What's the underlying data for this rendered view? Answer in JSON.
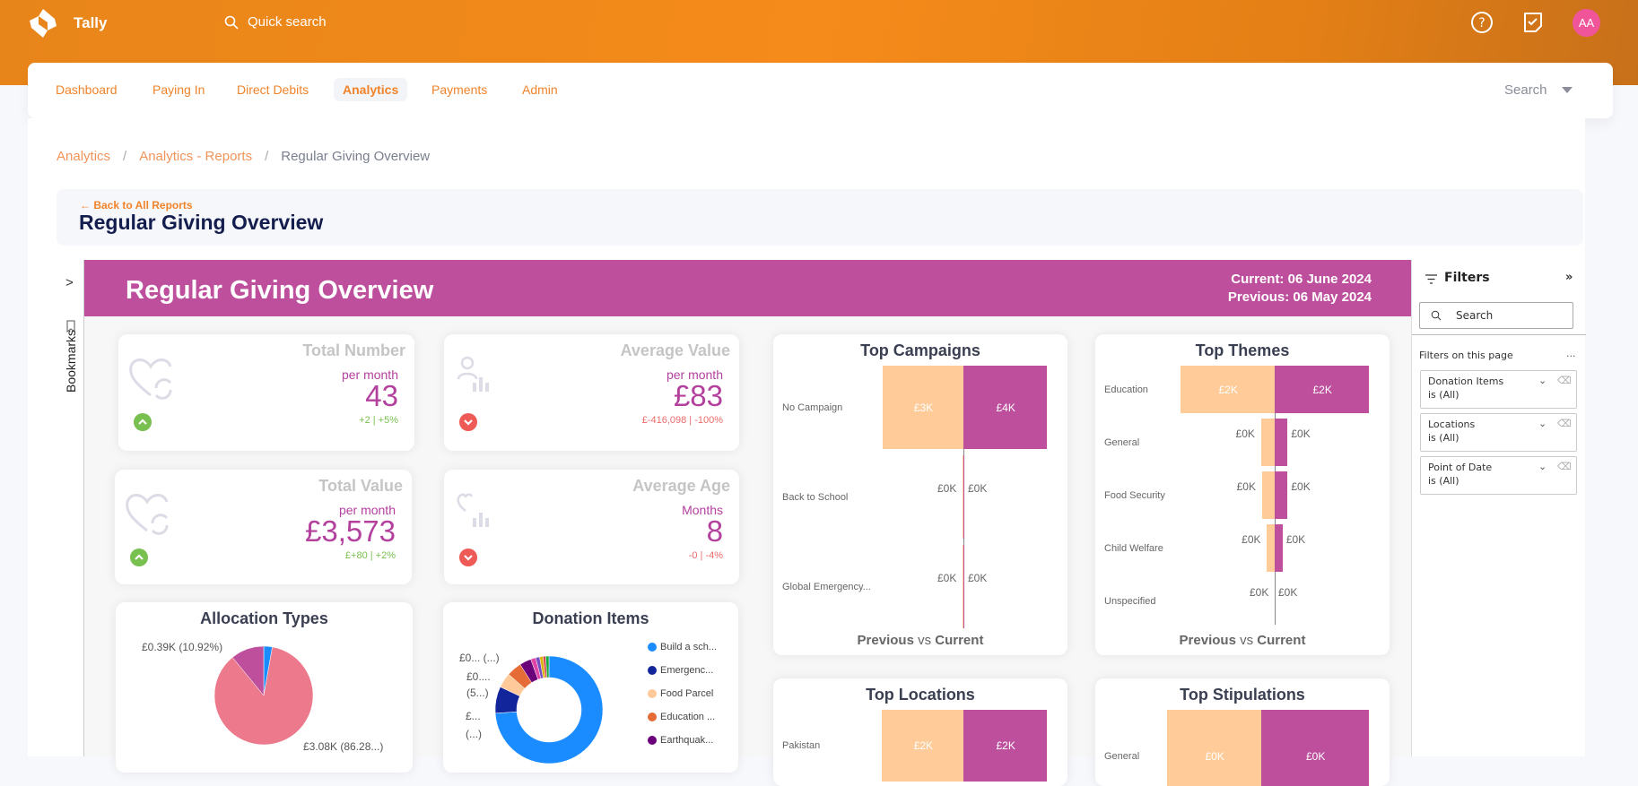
{
  "app": {
    "name": "Tally",
    "quick_search": "Quick search",
    "avatar_initials": "AA",
    "icons": [
      "logo-icon",
      "search-icon",
      "help-icon",
      "tasks-icon"
    ]
  },
  "colors": {
    "brand": "#f58b1a",
    "banner": "#bd4f9d",
    "previous": "#ffcc99",
    "current": "#bd4f9d",
    "up": "#78c050",
    "down": "#ee6a6a"
  },
  "nav": {
    "items": [
      {
        "label": "Dashboard"
      },
      {
        "label": "Paying In"
      },
      {
        "label": "Direct Debits"
      },
      {
        "label": "Analytics",
        "active": true
      },
      {
        "label": "Payments"
      },
      {
        "label": "Admin"
      }
    ],
    "search_label": "Search"
  },
  "breadcrumb": [
    "Analytics",
    "Analytics - Reports",
    "Regular Giving Overview"
  ],
  "page": {
    "back_label": "Back to All Reports",
    "title": "Regular Giving Overview"
  },
  "bookmarks": {
    "label": "Bookmarks"
  },
  "report": {
    "title": "Regular Giving Overview",
    "current": "Current:  06 June 2024",
    "previous": "Previous: 06 May 2024",
    "kpis": [
      {
        "title": "Total Number",
        "sub": "per month",
        "value": "43",
        "delta": "+2  |  +5%",
        "trend": "up"
      },
      {
        "title": "Average Value",
        "sub": "per month",
        "value": "£83",
        "delta": "£-416,098  |  -100%",
        "trend": "down"
      },
      {
        "title": "Total Value",
        "sub": "per month",
        "value": "£3,573",
        "delta": "£+80  |  +2%",
        "trend": "up"
      },
      {
        "title": "Average Age",
        "sub": "Months",
        "value": "8",
        "delta": "-0  |  -4%",
        "trend": "down"
      }
    ],
    "footer": {
      "prev": "Previous",
      "vs": "vs",
      "cur": "Current"
    }
  },
  "chart_data": [
    {
      "type": "bar",
      "title": "Top Campaigns",
      "categories": [
        "No Campaign",
        "Back to School",
        "Global Emergency..."
      ],
      "series": [
        {
          "name": "Previous",
          "values": [
            3.4,
            0.02,
            0.01
          ],
          "labels": [
            "£3K",
            "£0K",
            "£0K"
          ]
        },
        {
          "name": "Current",
          "values": [
            3.5,
            0.02,
            0.01
          ],
          "labels": [
            "£4K",
            "£0K",
            "£0K"
          ]
        }
      ],
      "unit": "£K"
    },
    {
      "type": "bar",
      "title": "Top Themes",
      "categories": [
        "Education",
        "General",
        "Food Security",
        "Child Welfare",
        "Unspecified"
      ],
      "series": [
        {
          "name": "Previous",
          "values": [
            1.9,
            0.28,
            0.26,
            0.16,
            0.0
          ],
          "labels": [
            "£2K",
            "£0K",
            "£0K",
            "£0K",
            "£0K"
          ]
        },
        {
          "name": "Current",
          "values": [
            1.9,
            0.26,
            0.26,
            0.16,
            0.0
          ],
          "labels": [
            "£2K",
            "£0K",
            "£0K",
            "£0K",
            "£0K"
          ]
        }
      ],
      "unit": "£K"
    },
    {
      "type": "bar",
      "title": "Top Locations",
      "categories": [
        "Pakistan"
      ],
      "series": [
        {
          "name": "Previous",
          "values": [
            1.9
          ],
          "labels": [
            "£2K"
          ]
        },
        {
          "name": "Current",
          "values": [
            1.95
          ],
          "labels": [
            "£2K"
          ]
        }
      ],
      "unit": "£K"
    },
    {
      "type": "bar",
      "title": "Top Stipulations",
      "categories": [
        "General"
      ],
      "series": [
        {
          "name": "Previous",
          "values": [
            0.42
          ],
          "labels": [
            "£0K"
          ]
        },
        {
          "name": "Current",
          "values": [
            0.48
          ],
          "labels": [
            "£0K"
          ]
        }
      ],
      "unit": "£K"
    },
    {
      "type": "pie",
      "title": "Allocation Types",
      "slices": [
        {
          "value": 2.8,
          "color": "#1a8cff"
        },
        {
          "value": 86.28,
          "color": "#ec7a8c",
          "label": "£3.08K (86.28...)"
        },
        {
          "value": 10.92,
          "color": "#bd4f9d",
          "label": "£0.39K (10.92%)"
        }
      ]
    },
    {
      "type": "pie",
      "donut": true,
      "title": "Donation Items",
      "slices": [
        {
          "name": "Build a sch...",
          "value": 74,
          "color": "#1a8cff"
        },
        {
          "name": "Emergenc...",
          "value": 8,
          "color": "#13259a"
        },
        {
          "name": "Food Parcel",
          "value": 4.5,
          "color": "#ffc999"
        },
        {
          "name": "Education ...",
          "value": 4.5,
          "color": "#e66c37"
        },
        {
          "name": "Earthquak...",
          "value": 3.5,
          "color": "#6b007b"
        },
        {
          "value": 1.5,
          "color": "#e044a7"
        },
        {
          "value": 1.2,
          "color": "#744ec2"
        },
        {
          "value": 1,
          "color": "#d9b300"
        },
        {
          "value": 0.8,
          "color": "#d64550"
        },
        {
          "value": 1,
          "color": "#1aab40"
        }
      ],
      "labels": [
        "£0... (...)",
        "£0....",
        "(5...)",
        "£...",
        "(...)"
      ]
    }
  ],
  "filters": {
    "title": "Filters",
    "search_placeholder": "Search",
    "section": "Filters on this page",
    "more": "...",
    "items": [
      {
        "name": "Donation Items",
        "value": "is (All)"
      },
      {
        "name": "Locations",
        "value": "is (All)"
      },
      {
        "name": "Point of Date",
        "value": "is (All)"
      }
    ]
  }
}
